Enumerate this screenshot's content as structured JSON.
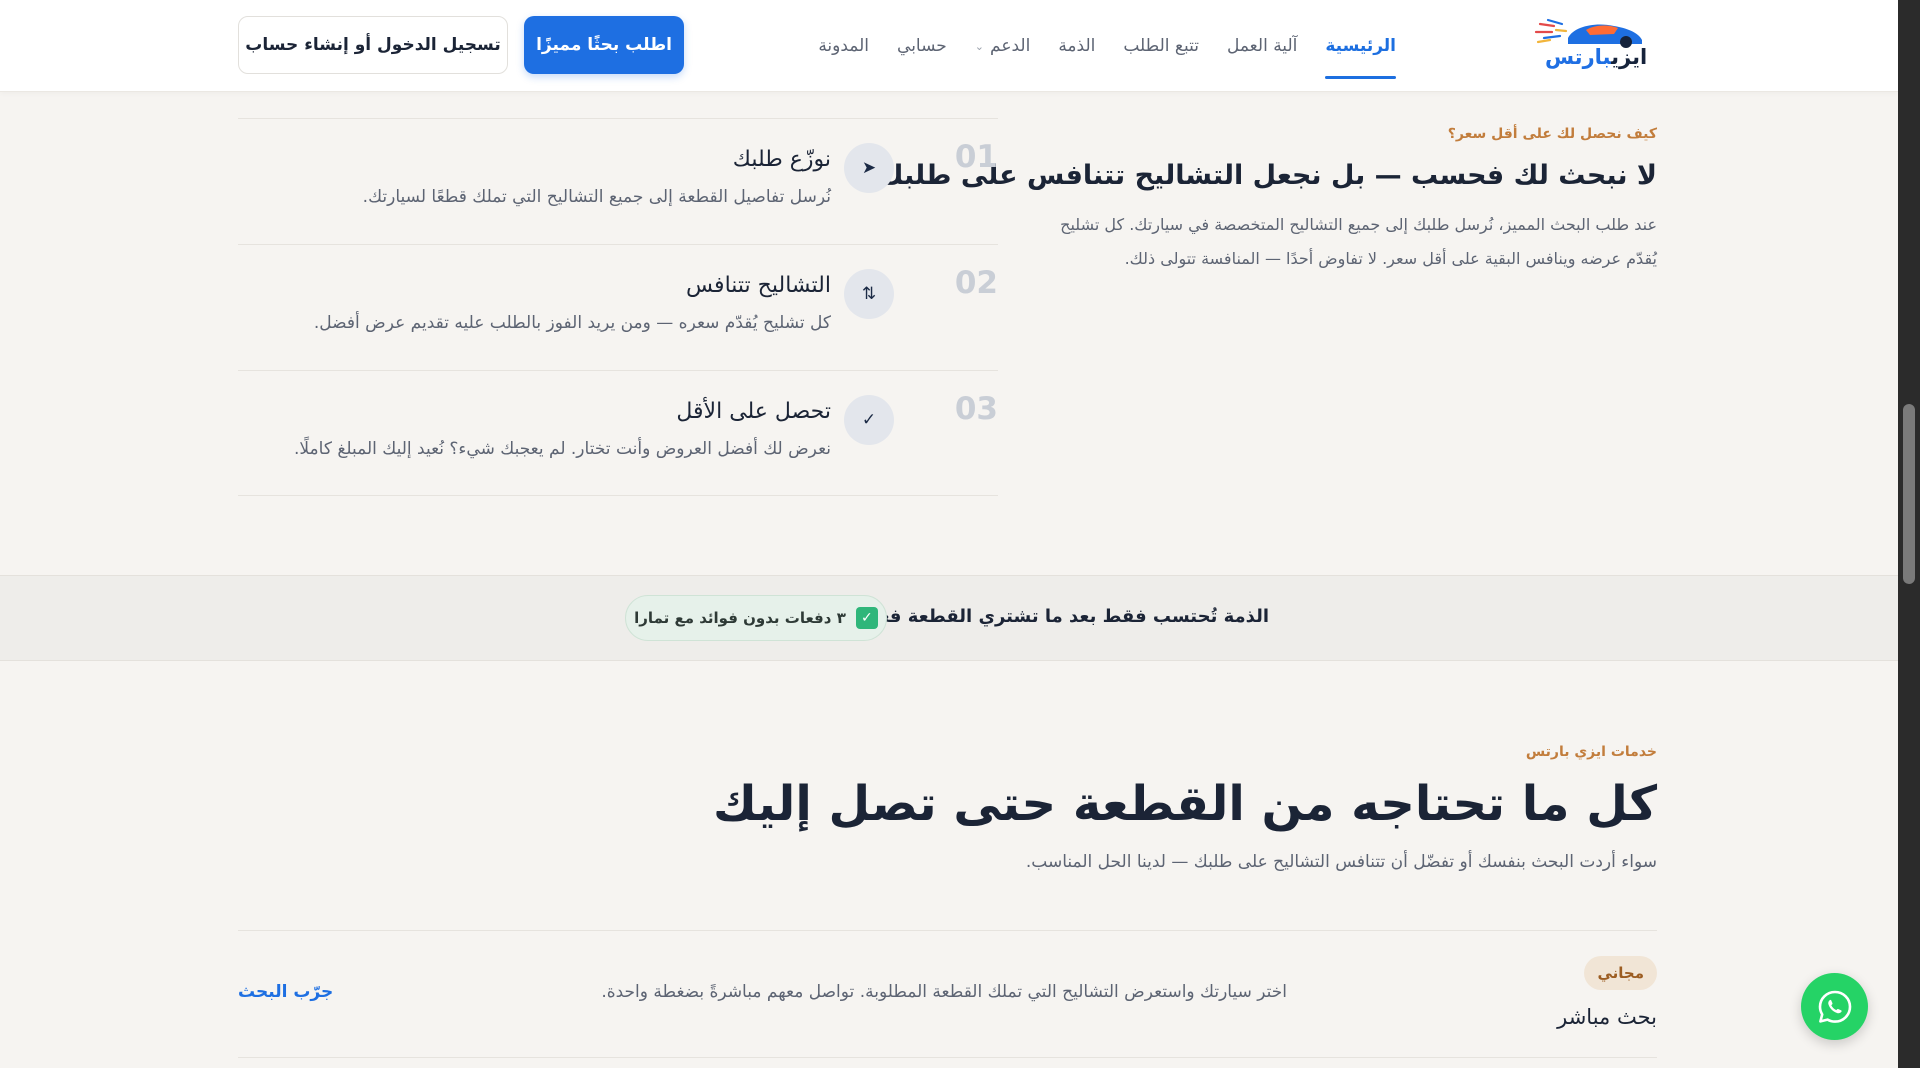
{
  "header": {
    "logo_text_main": "ايزي",
    "logo_text_accent": "بارتس",
    "nav": [
      {
        "label": "الرئيسية",
        "active": true
      },
      {
        "label": "آلية العمل",
        "active": false
      },
      {
        "label": "تتبع الطلب",
        "active": false
      },
      {
        "label": "الذمة",
        "active": false
      },
      {
        "label": "الدعم",
        "active": false,
        "dropdown": true
      },
      {
        "label": "حسابي",
        "active": false
      },
      {
        "label": "المدونة",
        "active": false
      }
    ],
    "primary_button": "اطلب بحثًا مميزًا",
    "secondary_button": "تسجيل الدخول أو إنشاء حساب"
  },
  "how": {
    "eyebrow": "كيف نحصل لك على أقل سعر؟",
    "title": "لا نبحث لك فحسب — بل نجعل التشاليح تتنافس على طلبك",
    "description": "عند طلب البحث المميز، نُرسل طلبك إلى جميع التشاليح المتخصصة في سيارتك. كل تشليح يُقدّم عرضه وينافس البقية على أقل سعر. لا تفاوض أحدًا — المنافسة تتولى ذلك.",
    "steps": [
      {
        "number": "01",
        "icon": "send-icon",
        "title": "نوزّع طلبك",
        "description": "نُرسل تفاصيل القطعة إلى جميع التشاليح التي تملك قطعًا لسيارتك."
      },
      {
        "number": "02",
        "icon": "swap-arrows-icon",
        "title": "التشاليح تتنافس",
        "description": "كل تشليح يُقدّم سعره — ومن يريد الفوز بالطلب عليه تقديم عرض أفضل."
      },
      {
        "number": "03",
        "icon": "check-icon",
        "title": "تحصل على الأقل",
        "description": "نعرض لك أفضل العروض وأنت تختار. لم يعجبك شيء؟ نُعيد إليك المبلغ كاملًا."
      }
    ]
  },
  "banner": {
    "text": "الذمة تُحتسب فقط بعد ما تشتري القطعة فعلاً",
    "pill_text": "٣ دفعات بدون فوائد مع تمارا"
  },
  "services": {
    "eyebrow": "خدمات ايزي بارتس",
    "title": "كل ما تحتاجه من القطعة حتى تصل إليك",
    "description": "سواء أردت البحث بنفسك أو تفضّل أن تتنافس التشاليح على طلبك — لدينا الحل المناسب.",
    "items": [
      {
        "badge": "مجاني",
        "name": "بحث مباشر",
        "description": "اختر سيارتك واستعرض التشاليح التي تملك القطعة المطلوبة. تواصل معهم مباشرةً بضغطة واحدة.",
        "link": "جرّب البحث"
      }
    ]
  },
  "colors": {
    "accent": "#1e6fe2",
    "eyebrow": "#c27d3c",
    "whatsapp": "#25d366",
    "success": "#2fb67a"
  }
}
